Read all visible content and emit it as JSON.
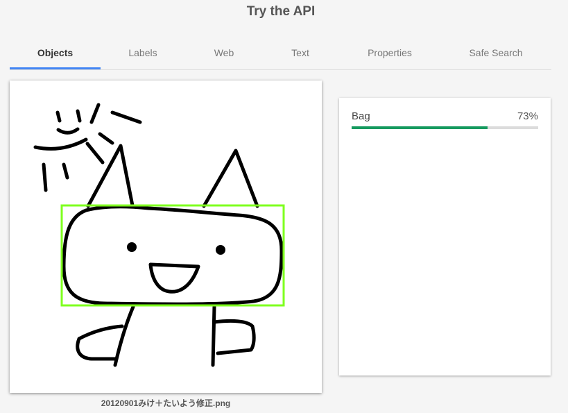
{
  "header": {
    "title": "Try the API"
  },
  "tabs": [
    {
      "label": "Objects",
      "active": true
    },
    {
      "label": "Labels",
      "active": false
    },
    {
      "label": "Web",
      "active": false
    },
    {
      "label": "Text",
      "active": false
    },
    {
      "label": "Properties",
      "active": false
    },
    {
      "label": "Safe Search",
      "active": false
    }
  ],
  "image": {
    "filename": "20120901みけ＋たいよう修正.png",
    "box_color": "#7fff1f"
  },
  "results": [
    {
      "label": "Bag",
      "score": "73%",
      "fraction": 0.73,
      "bar_color": "#159a5f"
    }
  ]
}
